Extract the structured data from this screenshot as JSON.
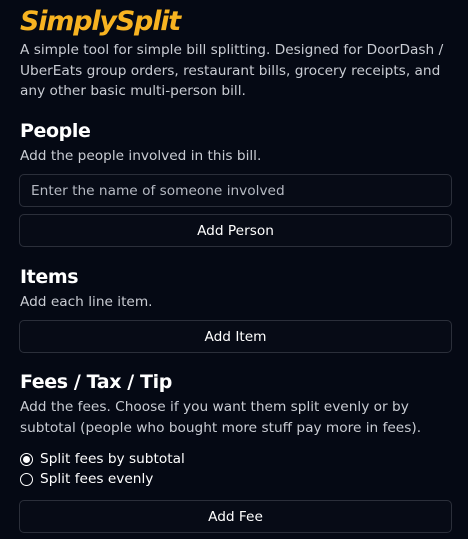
{
  "app": {
    "logo_text": "SimplySplit",
    "tagline": "A simple tool for simple bill splitting. Designed for DoorDash / UberEats group orders, restaurant bills, grocery receipts, and any other basic multi-person bill."
  },
  "people": {
    "heading": "People",
    "description": "Add the people involved in this bill.",
    "name_input_placeholder": "Enter the name of someone involved",
    "name_input_value": "",
    "add_button_label": "Add Person"
  },
  "items": {
    "heading": "Items",
    "description": "Add each line item.",
    "add_button_label": "Add Item"
  },
  "fees": {
    "heading": "Fees / Tax / Tip",
    "description": "Add the fees. Choose if you want them split evenly or by subtotal (people who bought more stuff pay more in fees).",
    "options": [
      {
        "label": "Split fees by subtotal",
        "selected": true
      },
      {
        "label": "Split fees evenly",
        "selected": false
      }
    ],
    "add_button_label": "Add Fee"
  },
  "colors": {
    "background": "#050914",
    "logo": "#f7b321",
    "muted_text": "#c9ccd3",
    "border": "#2b2f3a"
  }
}
